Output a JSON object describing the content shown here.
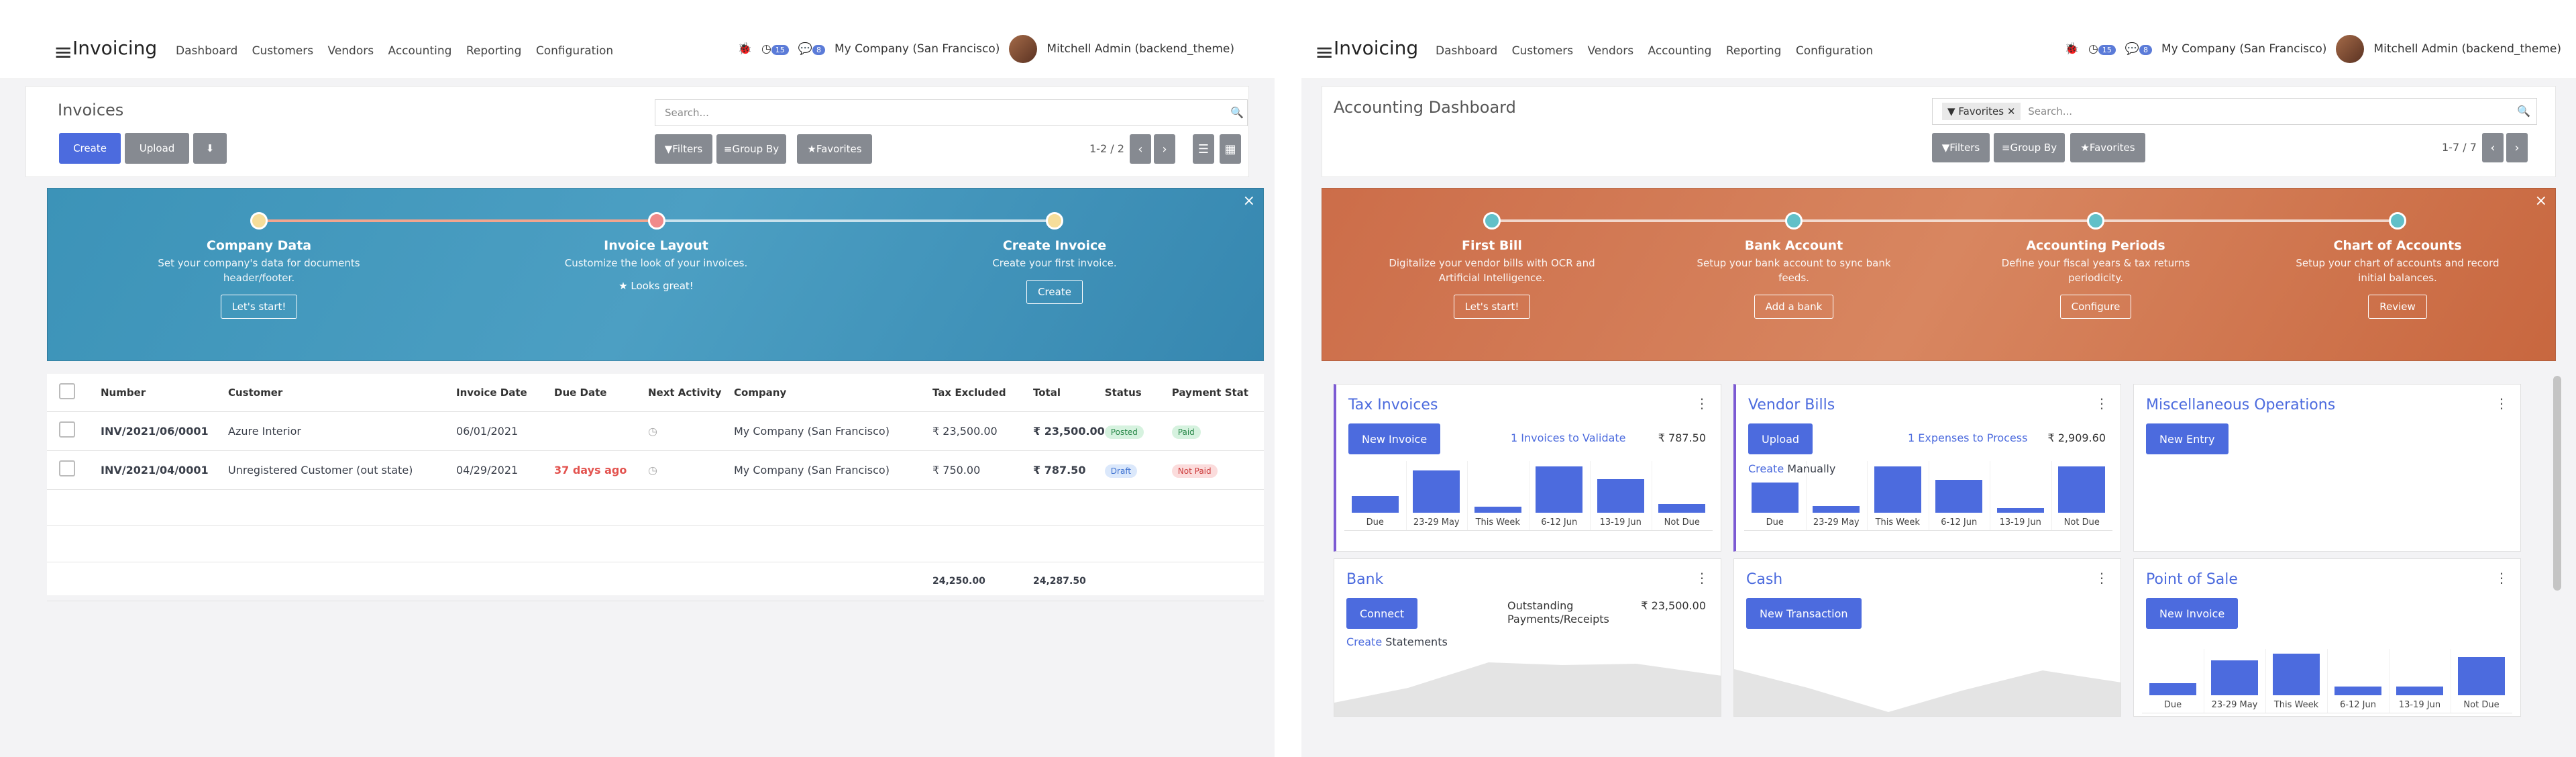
{
  "left": {
    "app": "Invoicing",
    "nav": [
      "Dashboard",
      "Customers",
      "Vendors",
      "Accounting",
      "Reporting",
      "Configuration"
    ],
    "badges": [
      "15",
      "8"
    ],
    "company": "My Company (San Francisco)",
    "user": "Mitchell Admin (backend_theme)",
    "title": "Invoices",
    "create": "Create",
    "upload": "Upload",
    "search_placeholder": "Search...",
    "filters": "Filters",
    "groupby": "Group By",
    "favorites": "Favorites",
    "pager": "1-2 / 2",
    "steps": [
      {
        "title": "Company Data",
        "desc": "Set your company's data for documents header/footer.",
        "btn": "Let's start!"
      },
      {
        "title": "Invoice Layout",
        "desc": "Customize the look of your invoices.",
        "done": "★ Looks great!"
      },
      {
        "title": "Create Invoice",
        "desc": "Create your first invoice.",
        "btn": "Create"
      }
    ],
    "columns": [
      "Number",
      "Customer",
      "Invoice Date",
      "Due Date",
      "Next Activity",
      "Company",
      "Tax Excluded",
      "Total",
      "Status",
      "Payment Stat"
    ],
    "rows": [
      {
        "number": "INV/2021/06/0001",
        "customer": "Azure Interior",
        "date": "06/01/2021",
        "due": "",
        "company": "My Company (San Francisco)",
        "tax": "₹ 23,500.00",
        "total": "₹ 23,500.00",
        "status": "Posted",
        "payment": "Paid"
      },
      {
        "number": "INV/2021/04/0001",
        "customer": "Unregistered Customer (out state)",
        "date": "04/29/2021",
        "due": "37 days ago",
        "company": "My Company (San Francisco)",
        "tax": "₹ 750.00",
        "total": "₹ 787.50",
        "status": "Draft",
        "payment": "Not Paid"
      }
    ],
    "sum_tax": "24,250.00",
    "sum_total": "24,287.50"
  },
  "right": {
    "app": "Invoicing",
    "nav": [
      "Dashboard",
      "Customers",
      "Vendors",
      "Accounting",
      "Reporting",
      "Configuration"
    ],
    "badges": [
      "15",
      "8"
    ],
    "company": "My Company (San Francisco)",
    "user": "Mitchell Admin (backend_theme)",
    "title": "Accounting Dashboard",
    "facet": "Favorites",
    "search_placeholder": "Search...",
    "filters": "Filters",
    "groupby": "Group By",
    "favorites": "Favorites",
    "pager": "1-7 / 7",
    "steps": [
      {
        "title": "First Bill",
        "desc": "Digitalize your vendor bills with OCR and Artificial Intelligence.",
        "btn": "Let's start!"
      },
      {
        "title": "Bank Account",
        "desc": "Setup your bank account to sync bank feeds.",
        "btn": "Add a bank"
      },
      {
        "title": "Accounting Periods",
        "desc": "Define your fiscal years & tax returns periodicity.",
        "btn": "Configure"
      },
      {
        "title": "Chart of Accounts",
        "desc": "Setup your chart of accounts and record initial balances.",
        "btn": "Review"
      }
    ],
    "cards": {
      "tax": {
        "title": "Tax Invoices",
        "btn": "New Invoice",
        "link": "1 Invoices to Validate",
        "amount": "₹ 787.50"
      },
      "bills": {
        "title": "Vendor Bills",
        "btn": "Upload",
        "link": "1 Expenses to Process",
        "amount": "₹ 2,909.60",
        "create": "Create",
        "manually": "Manually"
      },
      "misc": {
        "title": "Miscellaneous Operations",
        "btn": "New Entry"
      },
      "bank": {
        "title": "Bank",
        "btn": "Connect",
        "label": "Outstanding Payments/Receipts",
        "amount": "₹ 23,500.00",
        "create": "Create",
        "statements": "Statements"
      },
      "cash": {
        "title": "Cash",
        "btn": "New Transaction"
      },
      "pos": {
        "title": "Point of Sale",
        "btn": "New Invoice"
      }
    }
  },
  "chart_data": [
    {
      "type": "bar",
      "categories": [
        "Due",
        "23-29 May",
        "This Week",
        "6-12 Jun",
        "13-19 Jun",
        "Not Due"
      ],
      "values": [
        0.4,
        1.0,
        0.15,
        1.1,
        0.8,
        0.2
      ]
    },
    {
      "type": "bar",
      "categories": [
        "Due",
        "23-29 May",
        "This Week",
        "6-12 Jun",
        "13-19 Jun",
        "Not Due"
      ],
      "values": [
        0.9,
        0.2,
        1.4,
        1.0,
        0.15,
        1.4
      ]
    },
    {
      "type": "bar",
      "categories": [
        "Due",
        "23-29 May",
        "This Week",
        "6-12 Jun",
        "13-19 Jun",
        "Not Due"
      ],
      "values": [
        0.35,
        1.0,
        1.2,
        0.25,
        0.25,
        1.1
      ]
    }
  ]
}
